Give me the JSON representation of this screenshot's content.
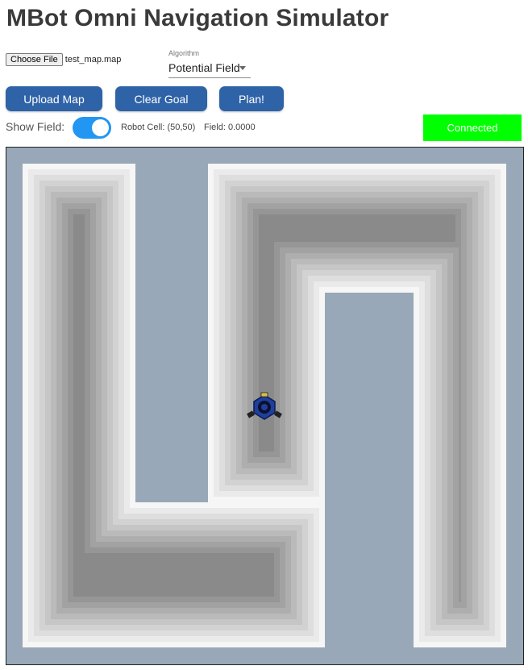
{
  "page": {
    "title": "MBot Omni Navigation Simulator"
  },
  "file": {
    "button_label": "Choose File",
    "file_name": "test_map.map"
  },
  "algorithm": {
    "label": "Algorithm",
    "selected": "Potential Field"
  },
  "buttons": {
    "upload": "Upload Map",
    "clear_goal": "Clear Goal",
    "plan": "Plan!"
  },
  "field": {
    "show_label": "Show Field:",
    "show_enabled": true,
    "robot_cell": "Robot Cell: (50,50)",
    "field_value": "Field:  0.0000"
  },
  "status": {
    "text": "Connected",
    "color": "#00ff00"
  },
  "colors": {
    "accent": "#2f63a7",
    "toggle": "#2196f3",
    "obstacle": "#98a8b8",
    "free_space": "#f4f4f4",
    "robot": "#1f3f9a"
  },
  "robot": {
    "icon": "robot-icon"
  }
}
